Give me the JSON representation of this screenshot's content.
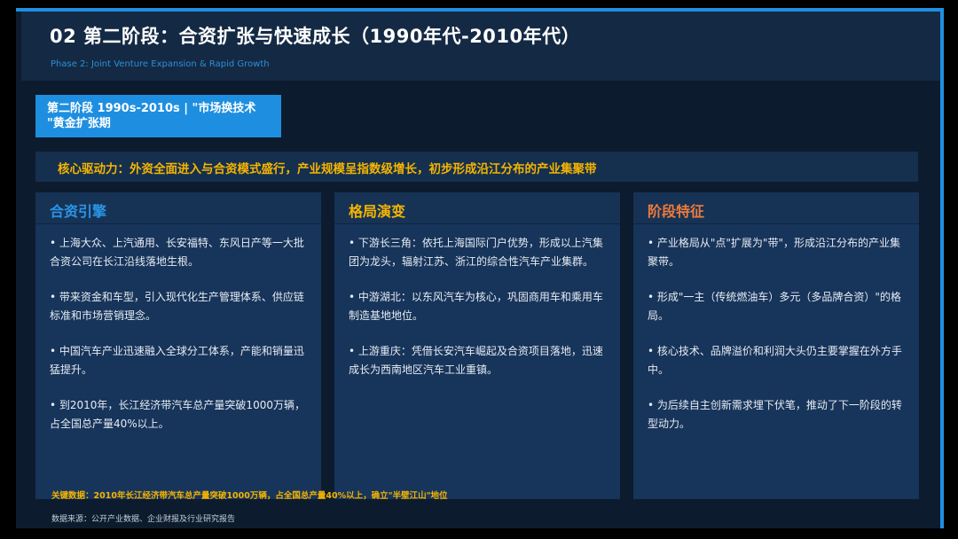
{
  "header": {
    "title": "02 第二阶段：合资扩张与快速成长（1990年代-2010年代）",
    "subtitle": "Phase 2: Joint Venture Expansion & Rapid Growth"
  },
  "stage_tag": {
    "line1": "第二阶段 1990s-2010s | \"市场换技术",
    "line2": "\"黄金扩张期"
  },
  "driver": "核心驱动力：外资全面进入与合资模式盛行，产业规模呈指数级增长，初步形成沿江分布的产业集聚带",
  "columns": [
    {
      "title": "合资引擎",
      "color": "#2a95e6",
      "items": [
        "• 上海大众、上汽通用、长安福特、东风日产等一大批合资公司在长江沿线落地生根。",
        "• 带来资金和车型，引入现代化生产管理体系、供应链标准和市场营销理念。",
        "• 中国汽车产业迅速融入全球分工体系，产能和销量迅猛提升。",
        "• 到2010年，长江经济带汽车总产量突破1000万辆，占全国总产量40%以上。"
      ]
    },
    {
      "title": "格局演变",
      "color": "#f5b400",
      "items": [
        "• 下游长三角：依托上海国际门户优势，形成以上汽集团为龙头，辐射江苏、浙江的综合性汽车产业集群。",
        "• 中游湖北：以东风汽车为核心，巩固商用车和乘用车制造基地地位。",
        "• 上游重庆：凭借长安汽车崛起及合资项目落地，迅速成长为西南地区汽车工业重镇。"
      ]
    },
    {
      "title": "阶段特征",
      "color": "#f07a3a",
      "items": [
        "• 产业格局从\"点\"扩展为\"带\"，形成沿江分布的产业集聚带。",
        "• 形成\"一主（传统燃油车）多元（多品牌合资）\"的格局。",
        "• 核心技术、品牌溢价和利润大头仍主要掌握在外方手中。",
        "• 为后续自主创新需求埋下伏笔，推动了下一阶段的转型动力。"
      ]
    }
  ],
  "footer": {
    "key_data": "关键数据：2010年长江经济带汽车总产量突破1000万辆，占全国总产量40%以上，确立\"半壁江山\"地位",
    "source": "数据来源：公开产业数据、企业财报及行业研究报告"
  }
}
